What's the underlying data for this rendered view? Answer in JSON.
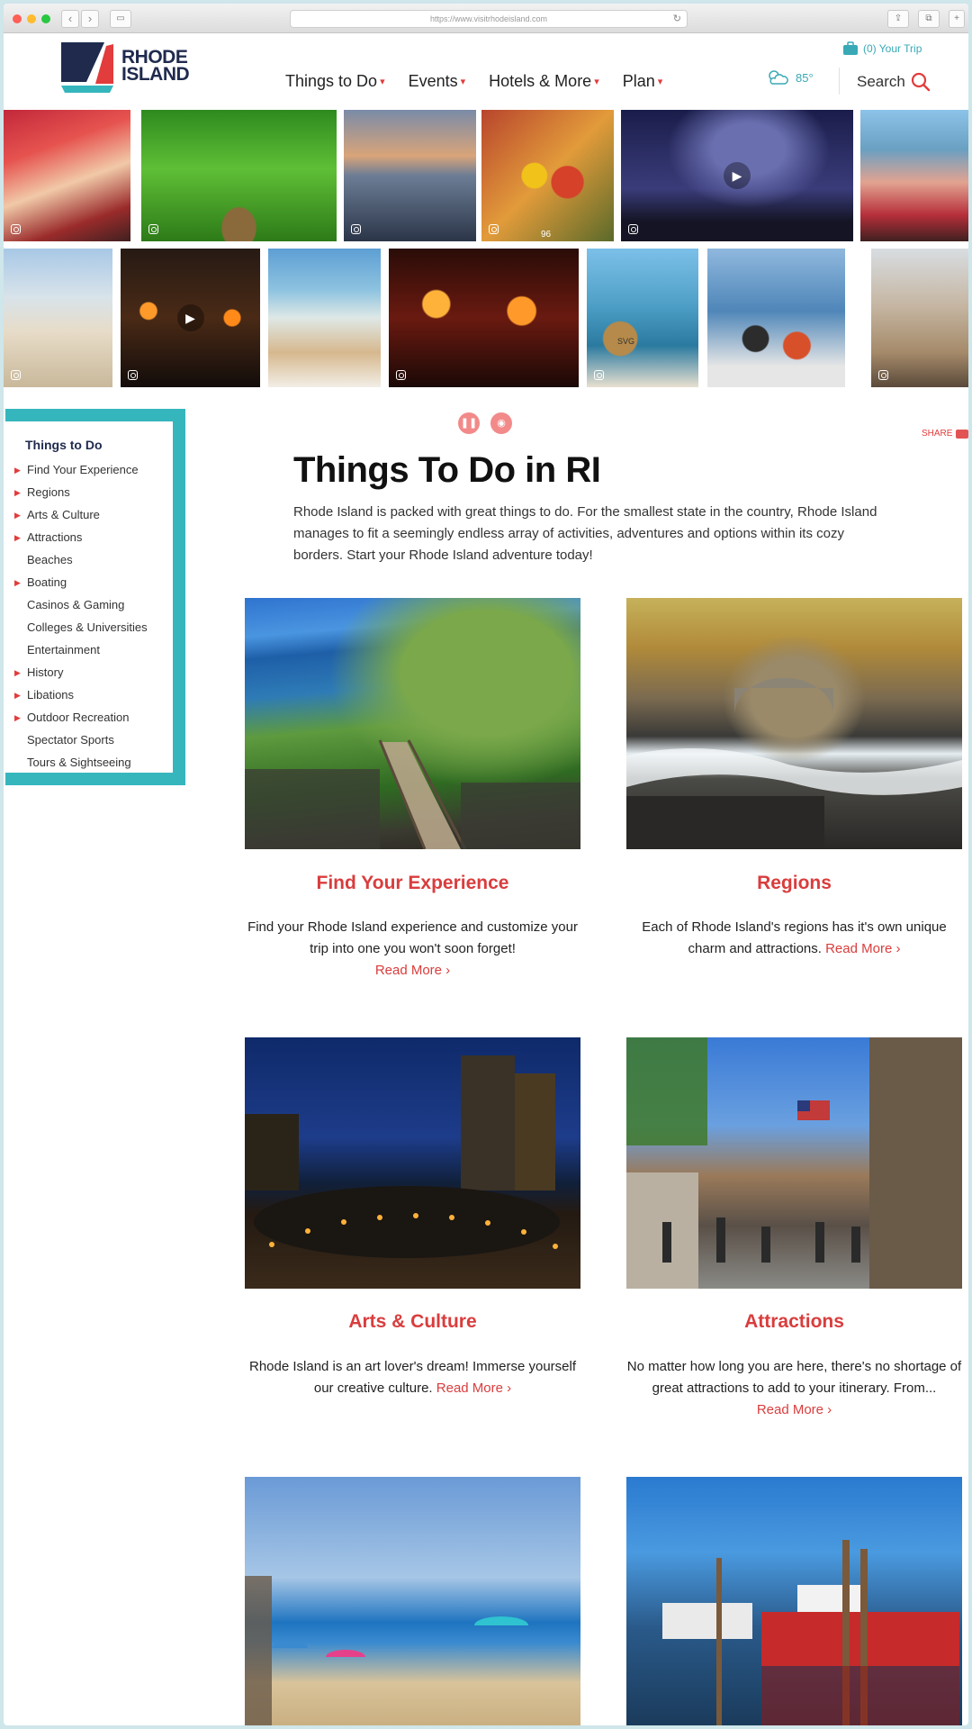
{
  "browser": {
    "url": "https://www.visitrhodeisland.com",
    "back_glyph": "‹",
    "forward_glyph": "›",
    "sidebar_glyph": "▭",
    "reload_glyph": "↻",
    "share_glyph": "⇪",
    "tabs_glyph": "⧉",
    "newtab_glyph": "+"
  },
  "header": {
    "logo_line1": "RHODE",
    "logo_line2": "ISLAND",
    "nav": [
      {
        "label": "Things to Do"
      },
      {
        "label": "Events"
      },
      {
        "label": "Hotels & More"
      },
      {
        "label": "Plan"
      }
    ],
    "caret_glyph": "▾",
    "trip_label": "(0) Your Trip",
    "temperature": "85°",
    "search_label": "Search"
  },
  "player": {
    "pause_glyph": "❚❚",
    "sound_glyph": "◉"
  },
  "share_label": "SHARE",
  "sidebar": {
    "title": "Things to Do",
    "items": [
      {
        "label": "Find Your Experience",
        "arrow": "▶"
      },
      {
        "label": "Regions",
        "arrow": "▶"
      },
      {
        "label": "Arts & Culture",
        "arrow": "▶"
      },
      {
        "label": "Attractions",
        "arrow": "▶"
      },
      {
        "label": "Beaches",
        "arrow": ""
      },
      {
        "label": "Boating",
        "arrow": "▶"
      },
      {
        "label": "Casinos & Gaming",
        "arrow": ""
      },
      {
        "label": "Colleges & Universities",
        "arrow": ""
      },
      {
        "label": "Entertainment",
        "arrow": ""
      },
      {
        "label": "History",
        "arrow": "▶"
      },
      {
        "label": "Libations",
        "arrow": "▶"
      },
      {
        "label": "Outdoor Recreation",
        "arrow": "▶"
      },
      {
        "label": "Spectator Sports",
        "arrow": ""
      },
      {
        "label": "Tours & Sightseeing",
        "arrow": ""
      }
    ]
  },
  "main": {
    "title": "Things To Do in RI",
    "intro": "Rhode Island is packed with great things to do. For the smallest state in the country, Rhode Island manages to fit a seemingly endless array of activities, adventures and options within its cozy borders. Start your Rhode Island adventure today!",
    "cards": [
      {
        "title": "Find Your Experience",
        "desc": "Find your Rhode Island experience and customize your trip into one you won't soon forget!",
        "read_more": "Read More ›"
      },
      {
        "title": "Regions",
        "desc": "Each of Rhode Island's regions has it's own unique charm and attractions.",
        "read_more": "Read More ›"
      },
      {
        "title": "Arts & Culture",
        "desc": "Rhode Island is an art lover's dream! Immerse yourself our creative culture.",
        "read_more": "Read More ›"
      },
      {
        "title": "Attractions",
        "desc": "No matter how long you are here, there's no shortage of great attractions to add to your itinerary. From...",
        "read_more": "Read More ›"
      }
    ]
  },
  "photos": {
    "play_glyph": "▶",
    "food_caption": "96",
    "bag_caption": "SVG"
  },
  "colors": {
    "accent_red": "#d93d3d",
    "teal": "#35b6bd",
    "navy": "#1f2a4d"
  }
}
